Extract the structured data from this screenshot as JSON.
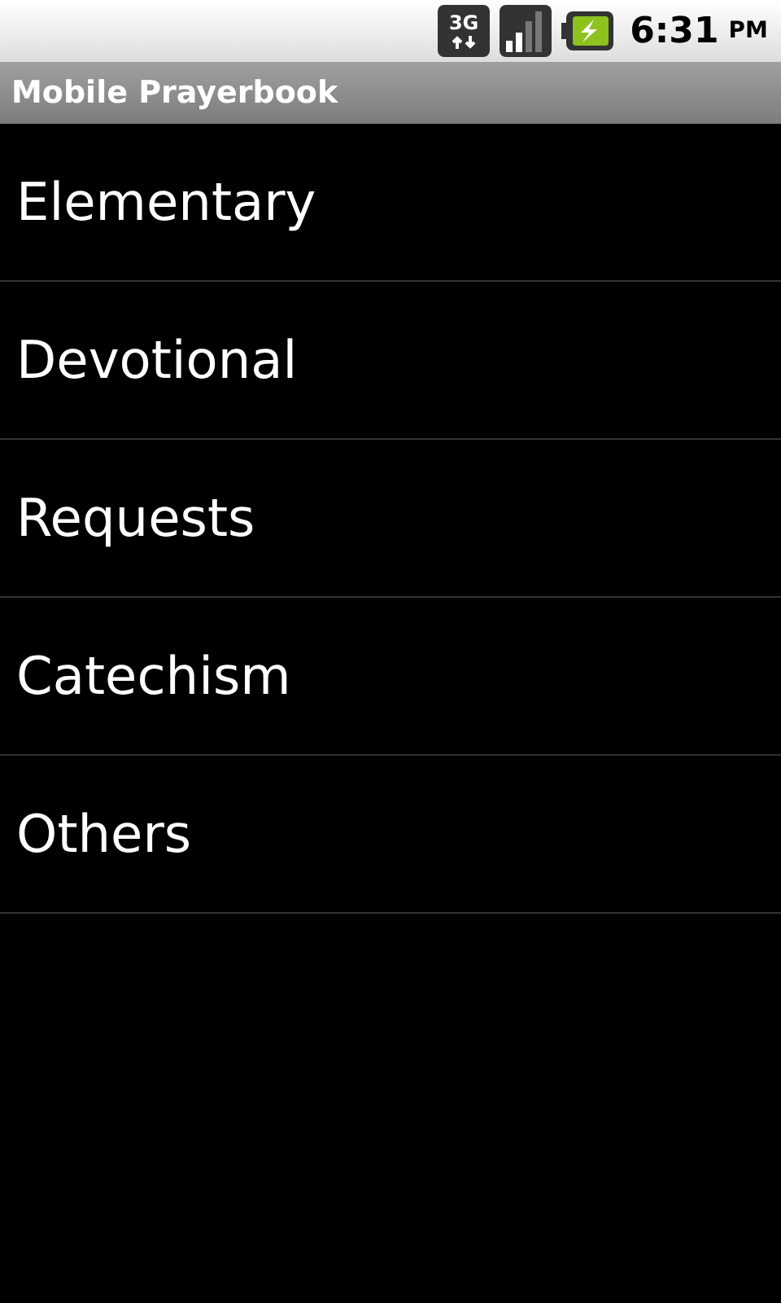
{
  "status_bar": {
    "network": "3G",
    "time": "6:31",
    "ampm": "PM"
  },
  "title_bar": {
    "title": "Mobile Prayerbook"
  },
  "menu": [
    {
      "label": "Elementary"
    },
    {
      "label": "Devotional"
    },
    {
      "label": "Requests"
    },
    {
      "label": "Catechism"
    },
    {
      "label": "Others"
    }
  ]
}
